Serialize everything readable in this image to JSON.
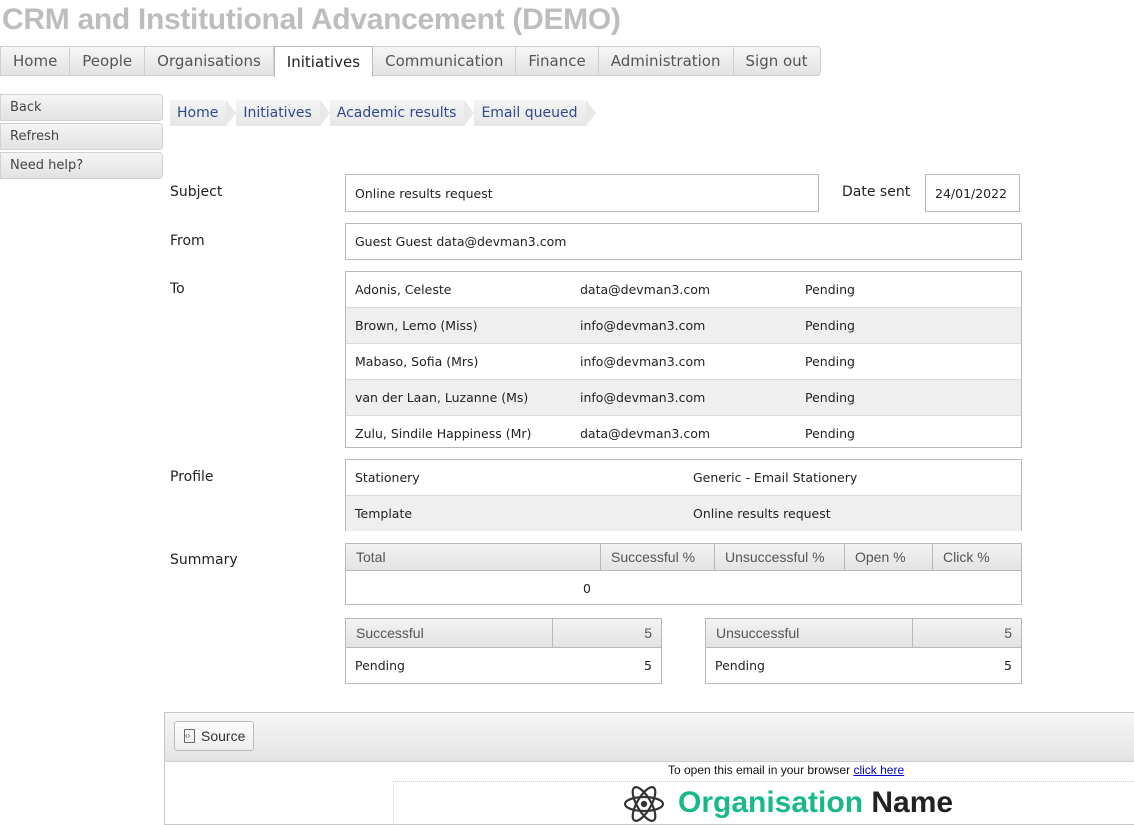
{
  "app_title": "CRM and Institutional Advancement (DEMO)",
  "nav": {
    "tabs": [
      "Home",
      "People",
      "Organisations",
      "Initiatives",
      "Communication",
      "Finance",
      "Administration",
      "Sign out"
    ],
    "active": "Initiatives"
  },
  "sidebar": {
    "back": "Back",
    "refresh": "Refresh",
    "help": "Need help?"
  },
  "breadcrumb": [
    "Home",
    "Initiatives",
    "Academic results",
    "Email queued"
  ],
  "form": {
    "subject_label": "Subject",
    "subject_value": "Online results request",
    "date_sent_label": "Date sent",
    "date_sent_value": "24/01/2022",
    "from_label": "From",
    "from_value": "Guest Guest data@devman3.com",
    "to_label": "To",
    "recipients": [
      {
        "name": "Adonis, Celeste",
        "email": "data@devman3.com",
        "status": "Pending"
      },
      {
        "name": "Brown, Lemo (Miss)",
        "email": "info@devman3.com",
        "status": "Pending"
      },
      {
        "name": "Mabaso, Sofia (Mrs)",
        "email": "info@devman3.com",
        "status": "Pending"
      },
      {
        "name": "van der Laan, Luzanne (Ms)",
        "email": "info@devman3.com",
        "status": "Pending"
      },
      {
        "name": "Zulu, Sindile Happiness (Mr)",
        "email": "data@devman3.com",
        "status": "Pending"
      }
    ],
    "profile_label": "Profile",
    "profile": [
      {
        "key": "Stationery",
        "value": "Generic - Email Stationery"
      },
      {
        "key": "Template",
        "value": "Online results request"
      }
    ],
    "summary_label": "Summary",
    "summary_headers": [
      "Total",
      "Successful %",
      "Unsuccessful %",
      "Open %",
      "Click %"
    ],
    "summary_total": "0",
    "successful": {
      "title": "Successful",
      "count": "5",
      "row_label": "Pending",
      "row_value": "5"
    },
    "unsuccessful": {
      "title": "Unsuccessful",
      "count": "5",
      "row_label": "Pending",
      "row_value": "5"
    }
  },
  "editor": {
    "source_label": "Source",
    "browser_text": "To open this email in your browser",
    "browser_link": "click here",
    "org_word1": "Organisation",
    "org_word2": "Name"
  },
  "colors": {
    "title_grey": "#bdbdbd",
    "link_blue": "#2f4a8a",
    "org_green": "#19b88a"
  }
}
